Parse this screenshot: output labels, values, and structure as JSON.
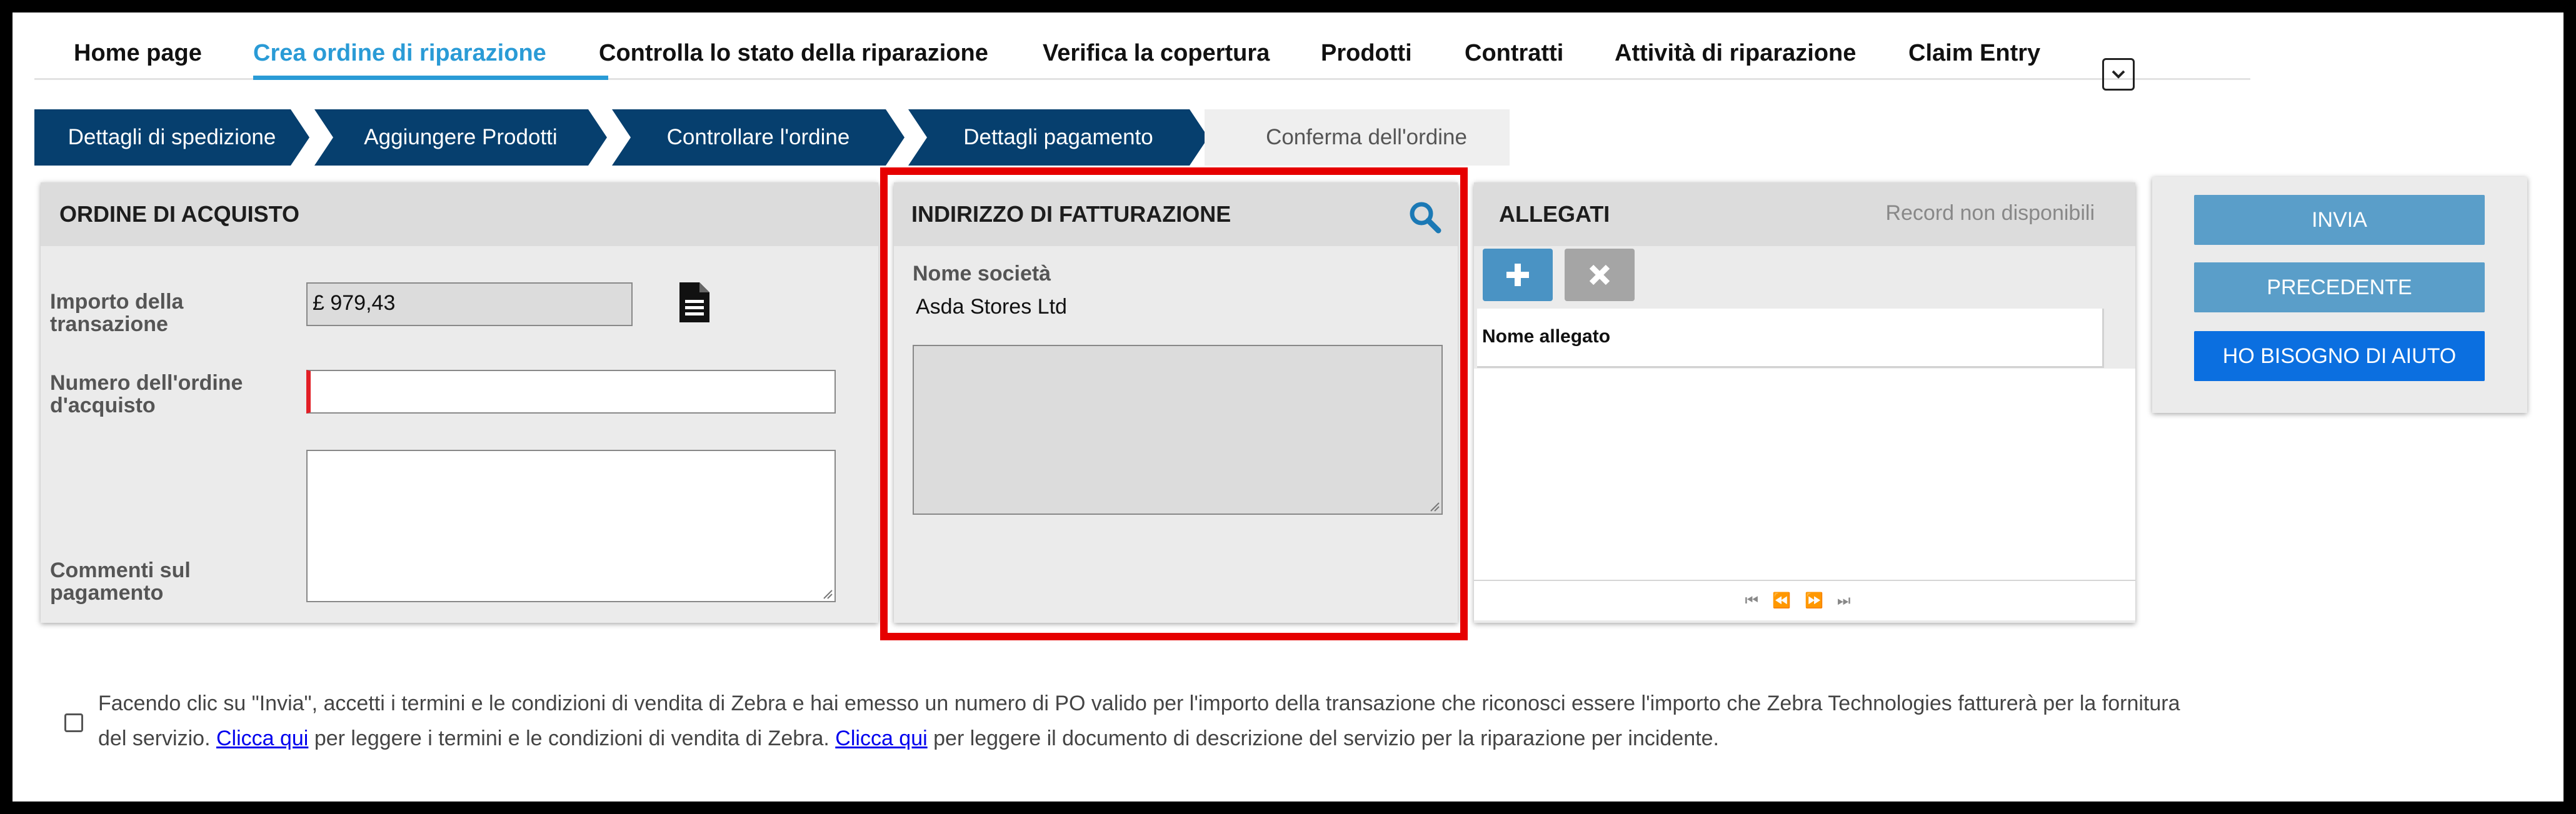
{
  "nav": {
    "items": [
      {
        "label": "Home page"
      },
      {
        "label": "Crea ordine di riparazione"
      },
      {
        "label": "Controlla lo stato della riparazione"
      },
      {
        "label": "Verifica la copertura"
      },
      {
        "label": "Prodotti"
      },
      {
        "label": "Contratti"
      },
      {
        "label": "Attività di riparazione"
      },
      {
        "label": "Claim Entry"
      }
    ],
    "active_index": 1,
    "more_icon": "chevron-down-icon"
  },
  "stepper": {
    "steps": [
      {
        "label": "Dettagli di spedizione"
      },
      {
        "label": "Aggiungere Prodotti"
      },
      {
        "label": "Controllare l'ordine"
      },
      {
        "label": "Dettagli pagamento"
      },
      {
        "label": "Conferma dell'ordine"
      }
    ],
    "active_color": "#063f6e",
    "inactive_color": "#efefef"
  },
  "purchase_order": {
    "title": "ORDINE DI ACQUISTO",
    "amount_label": "Importo della transazione",
    "amount_value": "£ 979,43",
    "document_icon": "document-icon",
    "po_number_label": "Numero dell'ordine d'acquisto",
    "po_number_value": "",
    "comments_label": "Commenti sul pagamento",
    "comments_value": ""
  },
  "billing": {
    "title": "INDIRIZZO DI FATTURAZIONE",
    "search_icon": "search-icon",
    "company_label": "Nome società",
    "company_value": "Asda Stores Ltd",
    "address_value": "",
    "highlight_color": "#e60000"
  },
  "attachments": {
    "title": "ALLEGATI",
    "status": "Record non disponibili",
    "add_icon": "plus-icon",
    "remove_icon": "close-icon",
    "column_header": "Nome allegato",
    "pager_icons": [
      "first-page-icon",
      "previous-page-icon",
      "next-page-icon",
      "last-page-icon"
    ]
  },
  "actions": {
    "submit_label": "INVIA",
    "previous_label": "PRECEDENTE",
    "help_label": "HO BISOGNO DI AIUTO",
    "submit_color": "#5a9ec9",
    "help_color": "#0b6fe0"
  },
  "terms": {
    "part1": "Facendo clic su \"Invia\", accetti i termini e le condizioni di vendita di Zebra e hai emesso un numero di PO valido per l'importo della transazione che riconosci essere l'importo che Zebra Technologies fatturerà per la fornitura del servizio.",
    "link1": "Clicca qui",
    "part2": "per leggere i termini e le condizioni di vendita di Zebra.",
    "link2": "Clicca qui",
    "part3": "per leggere il documento di descrizione del servizio per la riparazione per incidente.",
    "checked": false
  }
}
